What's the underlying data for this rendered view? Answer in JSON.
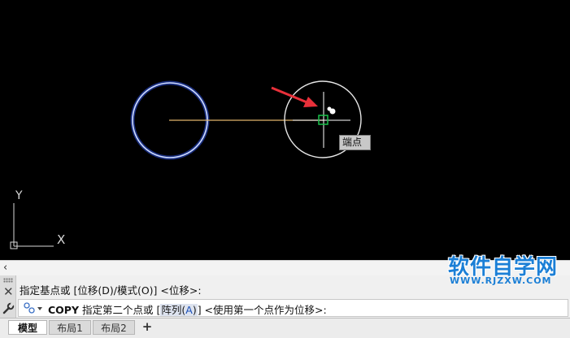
{
  "canvas": {
    "tooltip": "端点",
    "ucs": {
      "y_label": "Y",
      "x_label": "X"
    }
  },
  "command": {
    "history": "指定基点或 [位移(D)/模式(O)] <位移>:",
    "command_name": "COPY",
    "prompt_before": "指定第二个点或 [",
    "option_label": "阵列(",
    "option_key": "A",
    "option_close": ")",
    "prompt_after": "] <使用第一个点作为位移>:"
  },
  "tabs": [
    {
      "label": "模型",
      "active": true
    },
    {
      "label": "布局1",
      "active": false
    },
    {
      "label": "布局2",
      "active": false
    }
  ],
  "watermark": {
    "main": "软件自学网",
    "sub": "WWW.RJZXW.COM"
  },
  "colors": {
    "canvas_bg": "#000000",
    "selected_circle": "#6a8cff",
    "line": "#e0b46a",
    "snap_marker": "#19c24a",
    "arrow": "#e8303a",
    "watermark": "#1b7fd6"
  }
}
